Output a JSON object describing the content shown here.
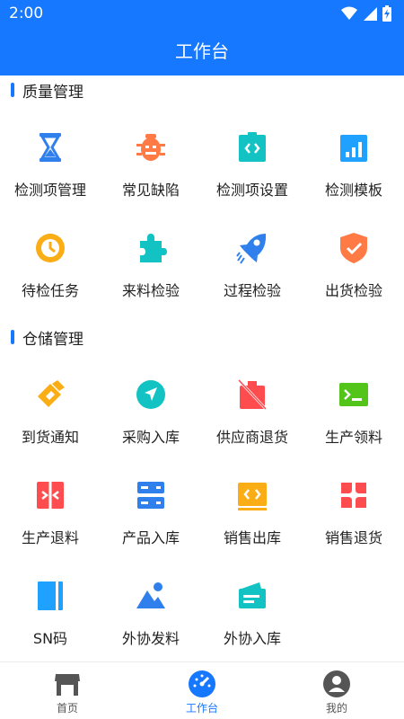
{
  "status": {
    "time": "2:00"
  },
  "header": {
    "title": "工作台"
  },
  "sections": [
    {
      "title": "质量管理",
      "items": [
        {
          "label": "检测项管理",
          "icon": "hourglass-icon"
        },
        {
          "label": "常见缺陷",
          "icon": "bug-icon"
        },
        {
          "label": "检测项设置",
          "icon": "code-icon"
        },
        {
          "label": "检测模板",
          "icon": "bar-chart-icon"
        },
        {
          "label": "待检任务",
          "icon": "clock-icon"
        },
        {
          "label": "来料检验",
          "icon": "puzzle-icon"
        },
        {
          "label": "过程检验",
          "icon": "rocket-icon"
        },
        {
          "label": "出货检验",
          "icon": "shield-check-icon"
        }
      ]
    },
    {
      "title": "仓储管理",
      "items": [
        {
          "label": "到货通知",
          "icon": "scanner-icon"
        },
        {
          "label": "采购入库",
          "icon": "navigation-icon"
        },
        {
          "label": "供应商退货",
          "icon": "return-box-icon"
        },
        {
          "label": "生产领料",
          "icon": "terminal-icon"
        },
        {
          "label": "生产退料",
          "icon": "collapse-icon"
        },
        {
          "label": "产品入库",
          "icon": "server-icon"
        },
        {
          "label": "销售出库",
          "icon": "code-window-icon"
        },
        {
          "label": "销售退货",
          "icon": "flower-icon"
        },
        {
          "label": "SN码",
          "icon": "book-icon"
        },
        {
          "label": "外协发料",
          "icon": "image-icon"
        },
        {
          "label": "外协入库",
          "icon": "wallet-icon"
        }
      ]
    }
  ],
  "nav": {
    "items": [
      {
        "label": "首页",
        "icon": "store-icon"
      },
      {
        "label": "工作台",
        "icon": "dashboard-icon"
      },
      {
        "label": "我的",
        "icon": "user-icon"
      }
    ],
    "active_index": 1
  },
  "colors": {
    "primary": "#1677ff",
    "blue": "#2f80ed",
    "orange": "#ff7a45",
    "teal": "#13c2c2",
    "cyan": "#1fa2ff",
    "amber": "#faad14",
    "green": "#52c41a",
    "red": "#ff4d4f"
  }
}
